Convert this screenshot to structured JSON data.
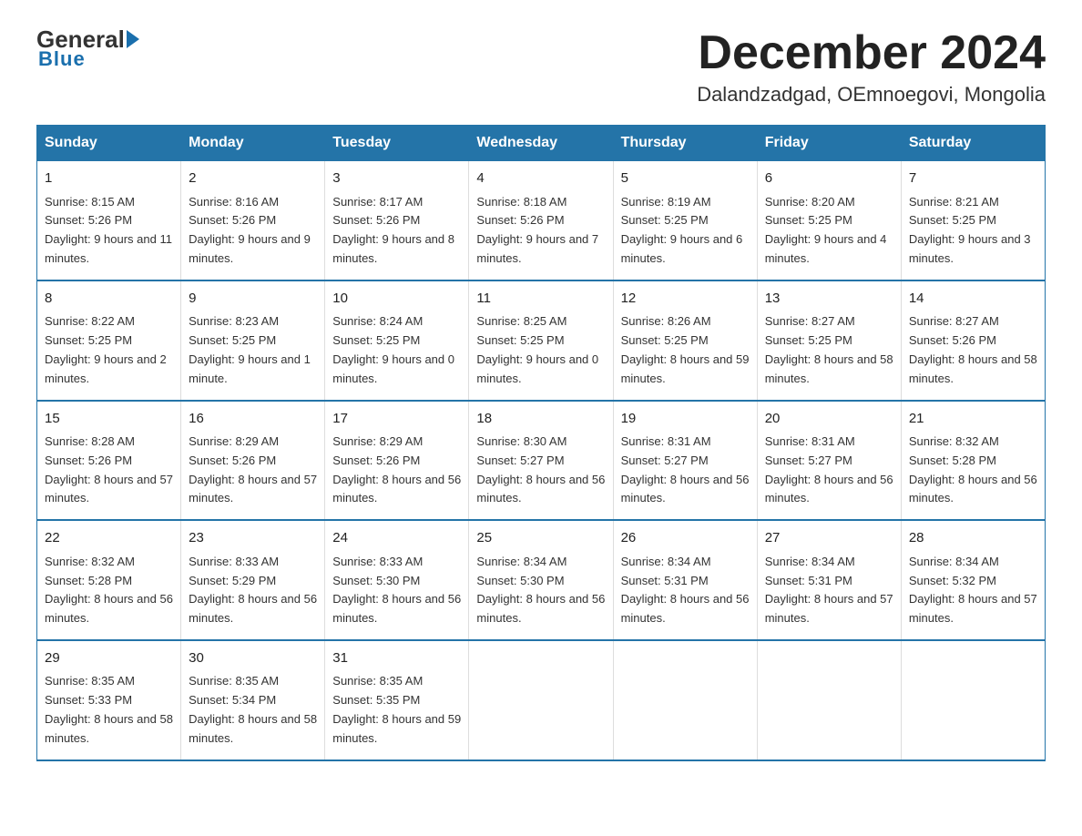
{
  "header": {
    "logo": {
      "general": "General",
      "blue": "Blue"
    },
    "title": "December 2024",
    "subtitle": "Dalandzadgad, OEmnoegovi, Mongolia"
  },
  "days_of_week": [
    "Sunday",
    "Monday",
    "Tuesday",
    "Wednesday",
    "Thursday",
    "Friday",
    "Saturday"
  ],
  "weeks": [
    [
      {
        "day": "1",
        "sunrise": "8:15 AM",
        "sunset": "5:26 PM",
        "daylight": "9 hours and 11 minutes."
      },
      {
        "day": "2",
        "sunrise": "8:16 AM",
        "sunset": "5:26 PM",
        "daylight": "9 hours and 9 minutes."
      },
      {
        "day": "3",
        "sunrise": "8:17 AM",
        "sunset": "5:26 PM",
        "daylight": "9 hours and 8 minutes."
      },
      {
        "day": "4",
        "sunrise": "8:18 AM",
        "sunset": "5:26 PM",
        "daylight": "9 hours and 7 minutes."
      },
      {
        "day": "5",
        "sunrise": "8:19 AM",
        "sunset": "5:25 PM",
        "daylight": "9 hours and 6 minutes."
      },
      {
        "day": "6",
        "sunrise": "8:20 AM",
        "sunset": "5:25 PM",
        "daylight": "9 hours and 4 minutes."
      },
      {
        "day": "7",
        "sunrise": "8:21 AM",
        "sunset": "5:25 PM",
        "daylight": "9 hours and 3 minutes."
      }
    ],
    [
      {
        "day": "8",
        "sunrise": "8:22 AM",
        "sunset": "5:25 PM",
        "daylight": "9 hours and 2 minutes."
      },
      {
        "day": "9",
        "sunrise": "8:23 AM",
        "sunset": "5:25 PM",
        "daylight": "9 hours and 1 minute."
      },
      {
        "day": "10",
        "sunrise": "8:24 AM",
        "sunset": "5:25 PM",
        "daylight": "9 hours and 0 minutes."
      },
      {
        "day": "11",
        "sunrise": "8:25 AM",
        "sunset": "5:25 PM",
        "daylight": "9 hours and 0 minutes."
      },
      {
        "day": "12",
        "sunrise": "8:26 AM",
        "sunset": "5:25 PM",
        "daylight": "8 hours and 59 minutes."
      },
      {
        "day": "13",
        "sunrise": "8:27 AM",
        "sunset": "5:25 PM",
        "daylight": "8 hours and 58 minutes."
      },
      {
        "day": "14",
        "sunrise": "8:27 AM",
        "sunset": "5:26 PM",
        "daylight": "8 hours and 58 minutes."
      }
    ],
    [
      {
        "day": "15",
        "sunrise": "8:28 AM",
        "sunset": "5:26 PM",
        "daylight": "8 hours and 57 minutes."
      },
      {
        "day": "16",
        "sunrise": "8:29 AM",
        "sunset": "5:26 PM",
        "daylight": "8 hours and 57 minutes."
      },
      {
        "day": "17",
        "sunrise": "8:29 AM",
        "sunset": "5:26 PM",
        "daylight": "8 hours and 56 minutes."
      },
      {
        "day": "18",
        "sunrise": "8:30 AM",
        "sunset": "5:27 PM",
        "daylight": "8 hours and 56 minutes."
      },
      {
        "day": "19",
        "sunrise": "8:31 AM",
        "sunset": "5:27 PM",
        "daylight": "8 hours and 56 minutes."
      },
      {
        "day": "20",
        "sunrise": "8:31 AM",
        "sunset": "5:27 PM",
        "daylight": "8 hours and 56 minutes."
      },
      {
        "day": "21",
        "sunrise": "8:32 AM",
        "sunset": "5:28 PM",
        "daylight": "8 hours and 56 minutes."
      }
    ],
    [
      {
        "day": "22",
        "sunrise": "8:32 AM",
        "sunset": "5:28 PM",
        "daylight": "8 hours and 56 minutes."
      },
      {
        "day": "23",
        "sunrise": "8:33 AM",
        "sunset": "5:29 PM",
        "daylight": "8 hours and 56 minutes."
      },
      {
        "day": "24",
        "sunrise": "8:33 AM",
        "sunset": "5:30 PM",
        "daylight": "8 hours and 56 minutes."
      },
      {
        "day": "25",
        "sunrise": "8:34 AM",
        "sunset": "5:30 PM",
        "daylight": "8 hours and 56 minutes."
      },
      {
        "day": "26",
        "sunrise": "8:34 AM",
        "sunset": "5:31 PM",
        "daylight": "8 hours and 56 minutes."
      },
      {
        "day": "27",
        "sunrise": "8:34 AM",
        "sunset": "5:31 PM",
        "daylight": "8 hours and 57 minutes."
      },
      {
        "day": "28",
        "sunrise": "8:34 AM",
        "sunset": "5:32 PM",
        "daylight": "8 hours and 57 minutes."
      }
    ],
    [
      {
        "day": "29",
        "sunrise": "8:35 AM",
        "sunset": "5:33 PM",
        "daylight": "8 hours and 58 minutes."
      },
      {
        "day": "30",
        "sunrise": "8:35 AM",
        "sunset": "5:34 PM",
        "daylight": "8 hours and 58 minutes."
      },
      {
        "day": "31",
        "sunrise": "8:35 AM",
        "sunset": "5:35 PM",
        "daylight": "8 hours and 59 minutes."
      },
      null,
      null,
      null,
      null
    ]
  ],
  "labels": {
    "sunrise": "Sunrise:",
    "sunset": "Sunset:",
    "daylight": "Daylight:"
  }
}
